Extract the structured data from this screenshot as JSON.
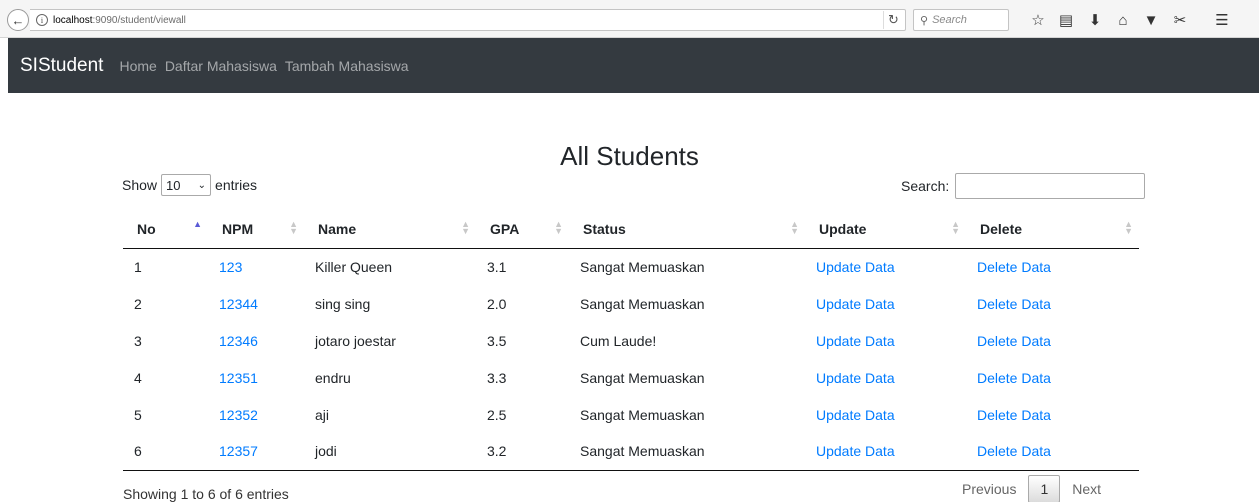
{
  "browser": {
    "url_host": "localhost",
    "url_path": ":9090/student/viewall",
    "search_placeholder": "Search"
  },
  "navbar": {
    "brand": "SIStudent",
    "links": [
      "Home",
      "Daftar Mahasiswa",
      "Tambah Mahasiswa"
    ]
  },
  "main": {
    "title": "All Students",
    "length_label_before": "Show",
    "length_value": "10",
    "length_label_after": "entries",
    "search_label": "Search:",
    "columns": [
      "No",
      "NPM",
      "Name",
      "GPA",
      "Status",
      "Update",
      "Delete"
    ],
    "rows": [
      {
        "no": "1",
        "npm": "123",
        "name": "Killer Queen",
        "gpa": "3.1",
        "status": "Sangat Memuaskan",
        "update": "Update Data",
        "delete": "Delete Data"
      },
      {
        "no": "2",
        "npm": "12344",
        "name": "sing sing",
        "gpa": "2.0",
        "status": "Sangat Memuaskan",
        "update": "Update Data",
        "delete": "Delete Data"
      },
      {
        "no": "3",
        "npm": "12346",
        "name": "jotaro joestar",
        "gpa": "3.5",
        "status": "Cum Laude!",
        "update": "Update Data",
        "delete": "Delete Data"
      },
      {
        "no": "4",
        "npm": "12351",
        "name": "endru",
        "gpa": "3.3",
        "status": "Sangat Memuaskan",
        "update": "Update Data",
        "delete": "Delete Data"
      },
      {
        "no": "5",
        "npm": "12352",
        "name": "aji",
        "gpa": "2.5",
        "status": "Sangat Memuaskan",
        "update": "Update Data",
        "delete": "Delete Data"
      },
      {
        "no": "6",
        "npm": "12357",
        "name": "jodi",
        "gpa": "3.2",
        "status": "Sangat Memuaskan",
        "update": "Update Data",
        "delete": "Delete Data"
      }
    ],
    "info": "Showing 1 to 6 of 6 entries",
    "pager": {
      "previous": "Previous",
      "page": "1",
      "next": "Next"
    }
  },
  "colors": {
    "navbar": "#343a40",
    "link": "#007bff"
  }
}
